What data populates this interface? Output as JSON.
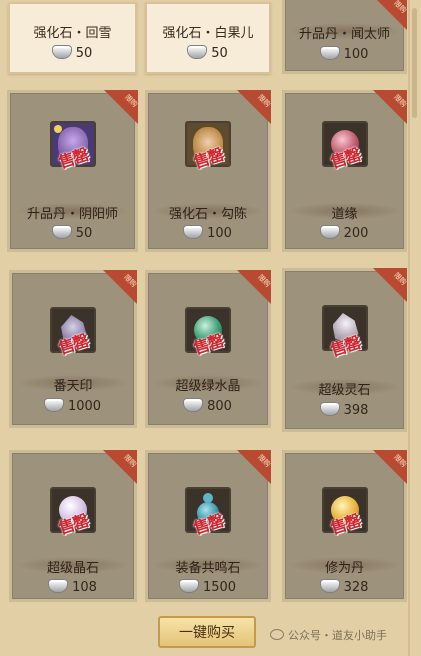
{
  "shop": {
    "cards": [
      {
        "name": "强化石・回雪",
        "price": "50",
        "sold": false,
        "limited": false,
        "stamp": "",
        "icon": ""
      },
      {
        "name": "强化石・白果儿",
        "price": "50",
        "sold": false,
        "limited": false,
        "stamp": "",
        "icon": ""
      },
      {
        "name": "升品丹・闻太师",
        "price": "100",
        "sold": true,
        "limited": true,
        "stamp": "",
        "icon": ""
      },
      {
        "name": "升品丹・阴阳师",
        "price": "50",
        "sold": true,
        "limited": true,
        "stamp": "售罄",
        "icon": "purple-portrait-icon"
      },
      {
        "name": "强化石・勾陈",
        "price": "100",
        "sold": true,
        "limited": true,
        "stamp": "售罄",
        "icon": "golden-haired-portrait-icon"
      },
      {
        "name": "道缘",
        "price": "200",
        "sold": true,
        "limited": true,
        "stamp": "售罄",
        "icon": "pink-orb-icon"
      },
      {
        "name": "番天印",
        "price": "1000",
        "sold": true,
        "limited": true,
        "stamp": "售罄",
        "icon": "seal-stone-icon"
      },
      {
        "name": "超级绿水晶",
        "price": "800",
        "sold": true,
        "limited": true,
        "stamp": "售罄",
        "icon": "green-crystal-icon"
      },
      {
        "name": "超级灵石",
        "price": "398",
        "sold": true,
        "limited": true,
        "stamp": "售罄",
        "icon": "spirit-stone-icon"
      },
      {
        "name": "超级晶石",
        "price": "108",
        "sold": true,
        "limited": true,
        "stamp": "售罄",
        "icon": "crystal-orb-icon"
      },
      {
        "name": "装备共鸣石",
        "price": "1500",
        "sold": true,
        "limited": true,
        "stamp": "售罄",
        "icon": "resonance-gourd-icon"
      },
      {
        "name": "修为丹",
        "price": "328",
        "sold": true,
        "limited": true,
        "stamp": "售罄",
        "icon": "golden-pill-icon"
      }
    ],
    "limit_label": "限购",
    "buy_all_label": "一键购买",
    "watermark": "公众号・道友小助手"
  },
  "colors": {
    "background": "#e2cfa6",
    "sold_card": "#9d927b",
    "available_card": "#f6ecd8",
    "stamp": "#cf2630",
    "limit_ribbon": "#b84a32",
    "button": "#e4c377"
  }
}
